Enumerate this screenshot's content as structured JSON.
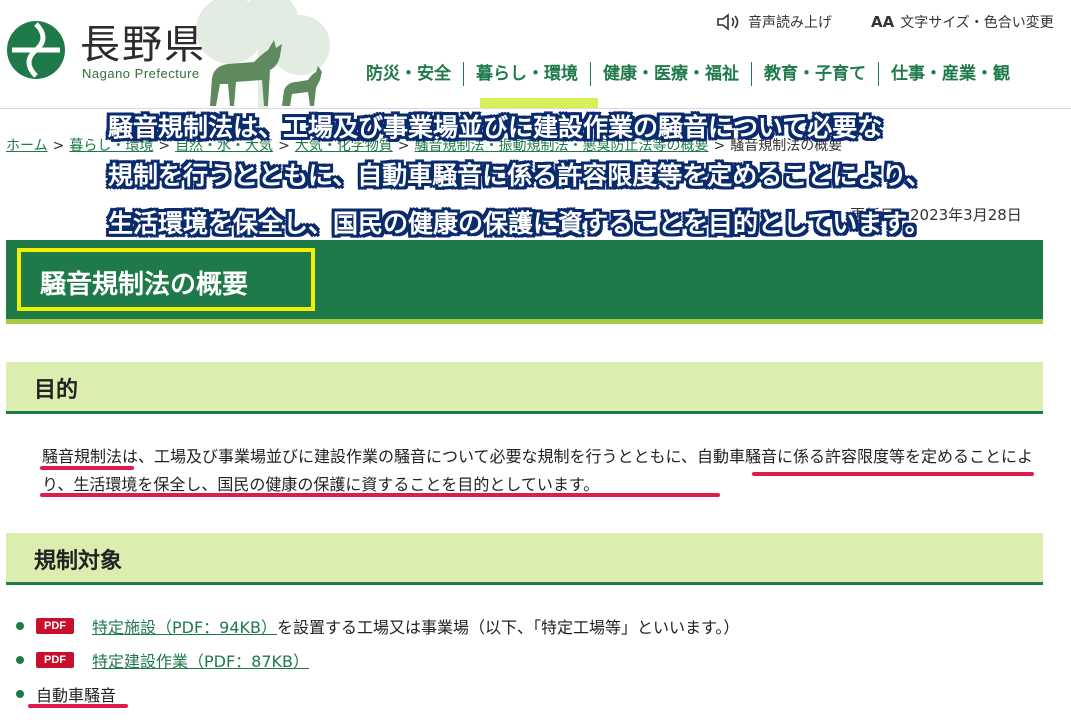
{
  "header": {
    "logo_name": "長野県",
    "logo_sub": "Nagano Prefecture",
    "voice_label": "音声読み上げ",
    "font_label": "文字サイズ・色合い変更",
    "font_icon_text": "AA",
    "nav": [
      "防災・安全",
      "暮らし・環境",
      "健康・医療・福祉",
      "教育・子育て",
      "仕事・産業・観"
    ]
  },
  "breadcrumb": {
    "items": [
      "ホーム",
      "暮らし・環境",
      "自然・水・大気",
      "大気・化学物質",
      "騒音規制法・振動規制法・悪臭防止法等の概要"
    ],
    "current": "騒音規制法の概要"
  },
  "updated_date": "更新日：2023年3月28日",
  "page_title": "騒音規制法の概要",
  "sections": {
    "purpose": {
      "heading": "目的",
      "text": "騒音規制法は、工場及び事業場並びに建設作業の騒音について必要な規制を行うとともに、自動車騒音に係る許容限度等を定めることにより、生活環境を保全し、国民の健康の保護に資することを目的としています。"
    },
    "scope": {
      "heading": "規制対象",
      "items": [
        {
          "badge": "PDF",
          "link": "特定施設（PDF：94KB）",
          "suffix": "を設置する工場又は事業場（以下、「特定工場等」といいます。）"
        },
        {
          "badge": "PDF",
          "link": "特定建設作業（PDF：87KB）",
          "suffix": ""
        },
        {
          "badge": "",
          "link": "",
          "suffix": "自動車騒音"
        }
      ]
    }
  },
  "overlay_caption": [
    "騒音規制法は、工場及び事業場並びに建設作業の騒音について必要な",
    "規制を行うとともに、自動車騒音に係る許容限度等を定めることにより、",
    "生活環境を保全し、国民の健康の保護に資することを目的としています。"
  ],
  "colors": {
    "brand_green": "#1f7a4a",
    "heading_bg": "#dbeeb0",
    "highlight_yellow": "#f1f000",
    "annotation_red": "#e01a4a",
    "caption_outline": "#0a2a6e"
  }
}
